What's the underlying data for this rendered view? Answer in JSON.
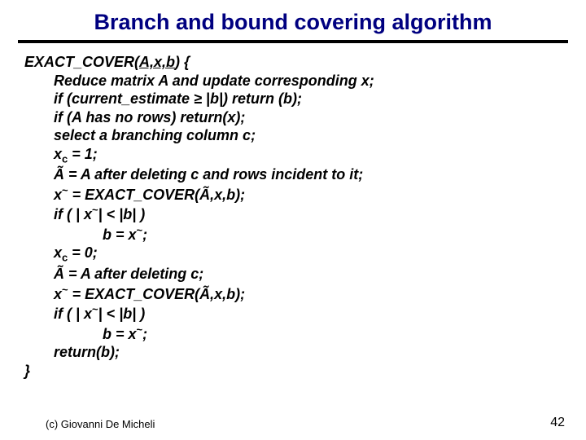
{
  "title": "Branch and bound covering algorithm",
  "fn_name": "EXACT_COVER(",
  "arg_A": "A,",
  "arg_x": "x,",
  "arg_b": "b",
  "fn_close": ") {",
  "l1": "Reduce matrix A and update corresponding x;",
  "l2": "if (current_estimate ≥ |b|) return (b);",
  "l3": "if (A has no rows) return(x);",
  "l4": "select a branching column c;",
  "l5_pre": "x",
  "l5_sub": "c",
  "l5_post": " = 1;",
  "l6": "Ã = A after deleting c and rows incident to it;",
  "l7_pre": "x",
  "l7_sup": "~",
  "l7_post": " = EXACT_COVER(Ã,x,b);",
  "l8_a": "if ( | x",
  "l8_sup": "~",
  "l8_b": "| < |b| )",
  "l9_a": "b = x",
  "l9_sup": "~",
  "l9_b": ";",
  "l10_pre": "x",
  "l10_sub": "c",
  "l10_post": " = 0;",
  "l11": "Ã = A after deleting c;",
  "l12_pre": "x",
  "l12_sup": "~",
  "l12_post": " = EXACT_COVER(Ã,x,b);",
  "l13_a": "if ( | x",
  "l13_sup": "~",
  "l13_b": "| < |b| )",
  "l14_a": "b = x",
  "l14_sup": "~",
  "l14_b": ";",
  "l15": "return(b);",
  "l16": "}",
  "footer_left": "(c)  Giovanni De Micheli",
  "footer_right": "42"
}
